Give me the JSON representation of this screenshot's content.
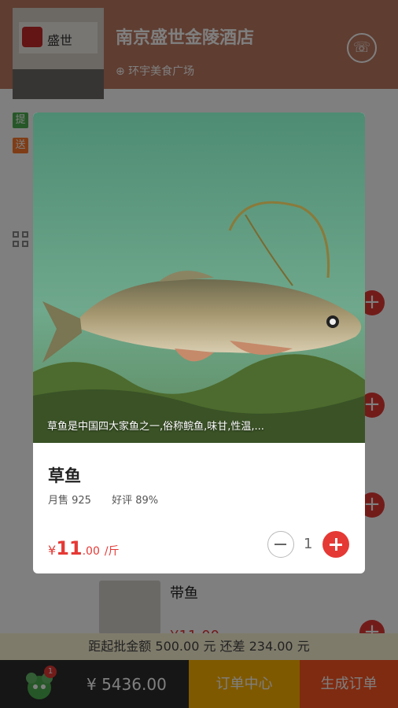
{
  "shop": {
    "name": "南京盛世金陵酒店",
    "location": "⊕ 环宇美食广场",
    "sign_text": "盛世"
  },
  "tags": [
    "提",
    "送"
  ],
  "menu": {
    "visible_item": {
      "name": "带鱼",
      "price": "¥11.00"
    }
  },
  "minimum_bar": "距起批金额 500.00 元 还差 234.00 元",
  "bottom": {
    "cart_badge": "1",
    "total": "¥ 5436.00",
    "order_center": "订单中心",
    "generate_order": "生成订单"
  },
  "modal": {
    "caption": "草鱼是中国四大家鱼之一,俗称鲩鱼,味甘,性温,...",
    "name": "草鱼",
    "monthly_sales": "月售 925",
    "rating": "好评 89%",
    "price_symbol": "¥",
    "price_int": "11",
    "price_dec": ".00",
    "price_unit": "/斤",
    "quantity": "1"
  },
  "colors": {
    "accent": "#e53935",
    "order_center": "#ffb300",
    "generate_order": "#ff5722"
  }
}
